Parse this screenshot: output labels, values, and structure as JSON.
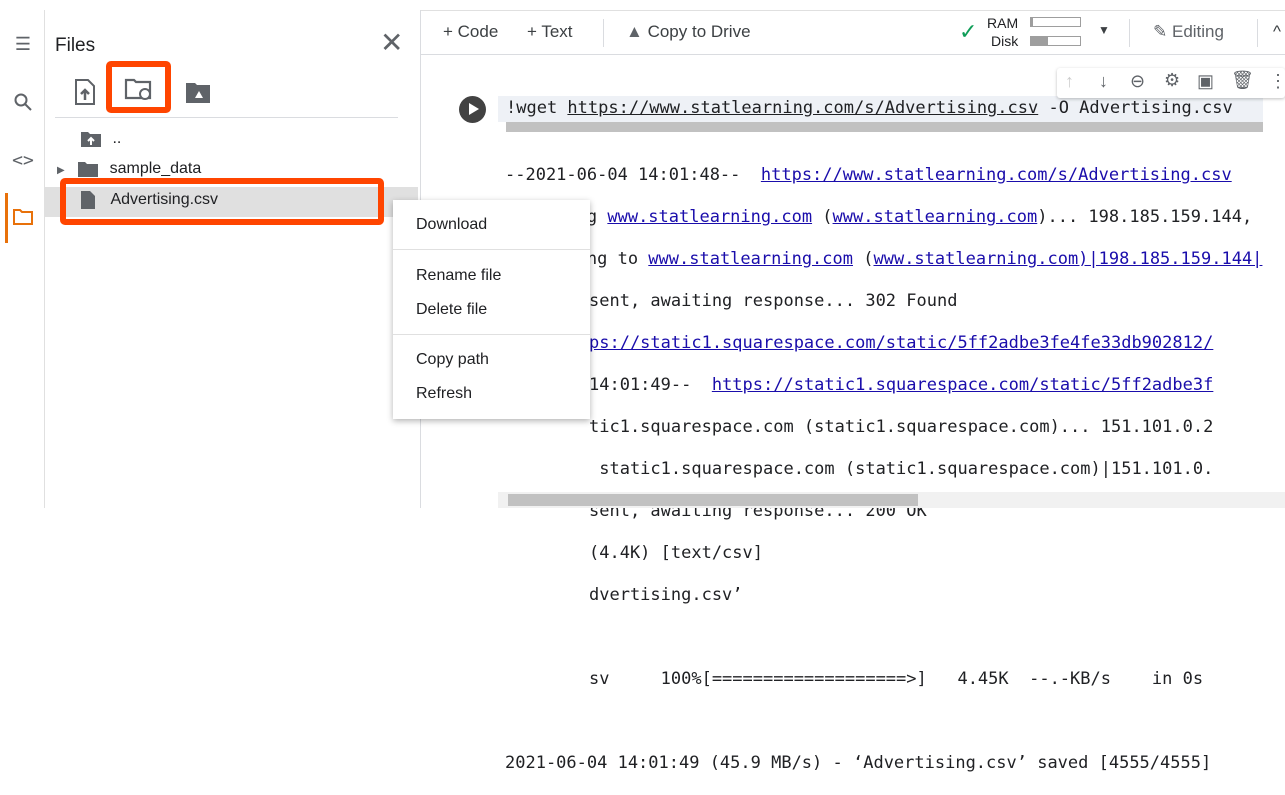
{
  "sidebar": {
    "title": "Files",
    "tree": [
      {
        "label": ".."
      },
      {
        "label": "sample_data"
      },
      {
        "label": "Advertising.csv"
      }
    ]
  },
  "toolbar": {
    "code": "+ Code",
    "text": "+ Text",
    "copy_drive": "Copy to Drive",
    "ram": "RAM",
    "disk": "Disk",
    "ram_fill": 0.05,
    "disk_fill": 0.35,
    "editing": "Editing"
  },
  "cell": {
    "cmd_prefix": "!wget ",
    "cmd_url": "https://www.statlearning.com/s/Advertising.csv",
    "cmd_suffix": " -O Advertising.csv"
  },
  "output": {
    "l1a": "--2021-06-04 14:01:48--  ",
    "l1b": "https://www.statlearning.com/s/Advertising.csv",
    "l2a": "Resolving ",
    "l2b": "www.statlearning.com",
    "l2c": " (",
    "l2d": "www.statlearning.com",
    "l2e": ")... 198.185.159.144,",
    "l3a": "Connecting to ",
    "l3b": "www.statlearning.com",
    "l3c": " (",
    "l3d": "www.statlearning.com)|198.185.159.144|",
    "l4": "sent, awaiting response... 302 Found",
    "l5": "ps://static1.squarespace.com/static/5ff2adbe3fe4fe33db902812/",
    "l6a": "14:01:49--  ",
    "l6b": "https://static1.squarespace.com/static/5ff2adbe3f",
    "l7": "tic1.squarespace.com (static1.squarespace.com)... 151.101.0.2",
    "l8": " static1.squarespace.com (static1.squarespace.com)|151.101.0.",
    "l9": "sent, awaiting response... 200 OK",
    "l10": "(4.4K) [text/csv]",
    "l11": "dvertising.csv’",
    "l12": "sv     100%[===================>]   4.45K  --.-KB/s    in 0s",
    "l13": "2021-06-04 14:01:49 (45.9 MB/s) - ‘Advertising.csv’ saved [4555/4555]"
  },
  "context_menu": {
    "items": [
      "Download",
      "Rename file",
      "Delete file",
      "Copy path",
      "Refresh"
    ]
  },
  "colors": {
    "highlight": "#ff4500",
    "accent": "#e8710a",
    "check": "#0f9d58"
  }
}
